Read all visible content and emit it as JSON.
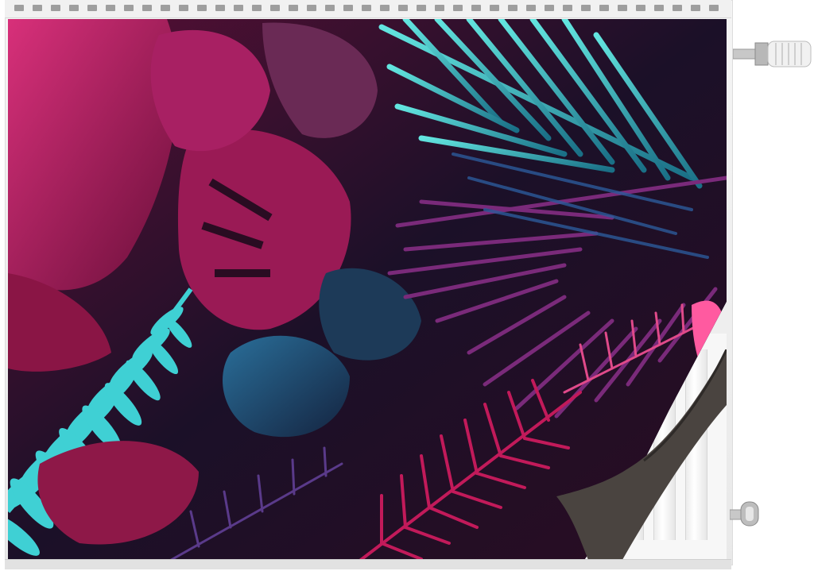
{
  "image": {
    "subject": "radiator-cover",
    "pattern": "tropical-neon-leaves",
    "colors": {
      "background": "#ffffff",
      "radiator": "#efefef",
      "cover_dark": "#1a0f22",
      "magenta": "#b8185e",
      "pink": "#d94a8c",
      "turquoise": "#3fd0d4",
      "teal": "#1f7f8f",
      "peel_back": "#4a4440"
    }
  }
}
